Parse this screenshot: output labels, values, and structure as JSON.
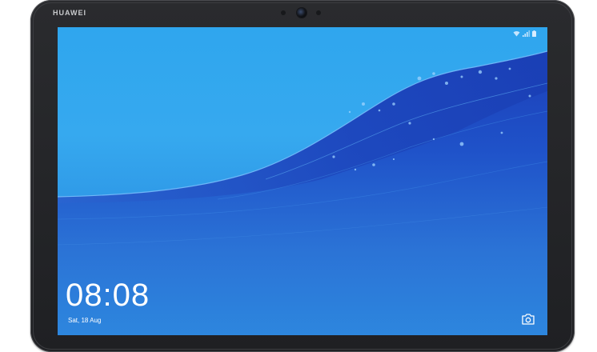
{
  "device": {
    "brand": "HUAWEI"
  },
  "lockscreen": {
    "time": "08:08",
    "date": "Sat, 18 Aug"
  },
  "status_bar": {
    "icons": [
      "wifi-icon",
      "signal-icon",
      "battery-icon"
    ]
  },
  "shortcuts": {
    "camera_icon": "camera-icon"
  },
  "colors": {
    "sky": "#36a9ef",
    "water_deep": "#1e55c8",
    "water_mid": "#2a6fd6",
    "bezel": "#232427"
  }
}
